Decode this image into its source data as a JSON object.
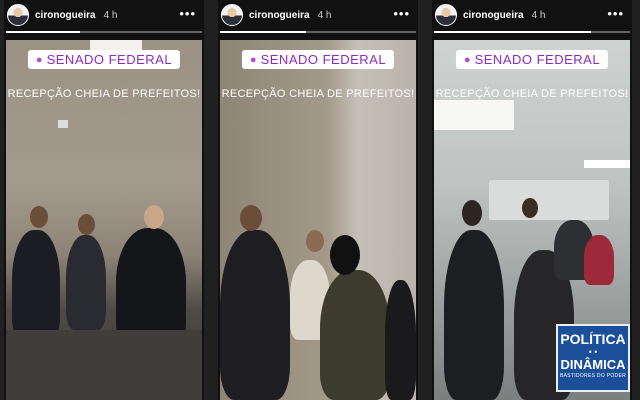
{
  "stories": [
    {
      "user": "cironogueira",
      "time": "4 h",
      "more": "•••",
      "location": "SENADO FEDERAL",
      "caption": "RECEPÇÃO CHEIA DE PREFEITOS!",
      "progress": 0.38
    },
    {
      "user": "cironogueira",
      "time": "4 h",
      "more": "•••",
      "location": "SENADO FEDERAL",
      "caption": "RECEPÇÃO CHEIA DE PREFEITOS!",
      "progress": 0.44
    },
    {
      "user": "cironogueira",
      "time": "4 h",
      "more": "•••",
      "location": "SENADO FEDERAL",
      "caption": "RECEPÇÃO CHEIA DE PREFEITOS!",
      "progress": 0.8
    }
  ],
  "icons": {
    "avatar": "avatar-icon",
    "pin": "location-pin-icon",
    "more": "more-options-icon"
  },
  "colors": {
    "badge_text": "#8b2bbf",
    "pin": "#b44ad8",
    "logo_bg": "#1b4f9a"
  },
  "watermark": {
    "line1": "POLÍTICA",
    "line2": "DINÂMICA",
    "line3": "BASTIDORES DO PODER"
  }
}
